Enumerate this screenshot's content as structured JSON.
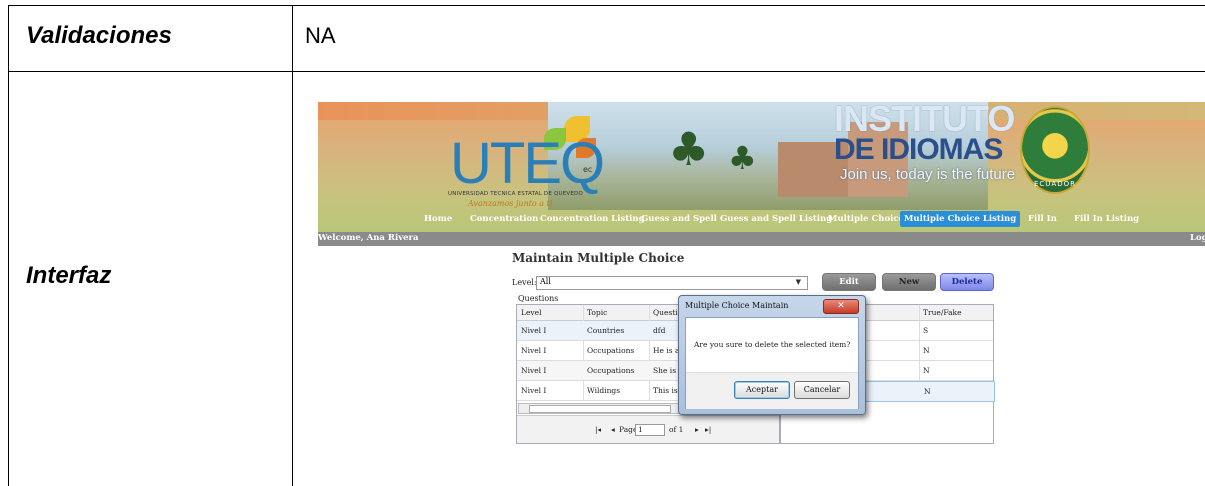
{
  "doc": {
    "row1_label": "Validaciones",
    "row1_value": "NA",
    "row2_label": "Interfaz"
  },
  "app": {
    "logo": {
      "name": "UTEQ",
      "superscript": "ec",
      "subtitle": "UNIVERSIDAD TECNICA ESTATAL DE QUEVEDO",
      "slogan": "Avanzamos junto a ti"
    },
    "institute": {
      "line1": "INSTITUTO",
      "line2": "DE IDIOMAS",
      "slogan": "Join us, today is the future",
      "seal_text": "ECUADOR"
    },
    "nav": [
      "Home",
      "Concentration",
      "Concentration Listing",
      "Guess and Spell",
      "Guess and Spell Listing",
      "Multiple Choice",
      "Multiple Choice Listing",
      "Fill In",
      "Fill In Listing"
    ],
    "nav_active_index": 6,
    "welcome": "Welcome, Ana Rivera",
    "logout_partial": "Log",
    "page_title": "Maintain Multiple Choice",
    "level_label": "Level:",
    "level_value": "All",
    "buttons": {
      "edit": "Edit",
      "new": "New",
      "delete": "Delete"
    },
    "grid": {
      "label": "Questions",
      "columns": [
        "Level",
        "Topic",
        "Questi"
      ],
      "rows": [
        [
          "Nivel I",
          "Countries",
          "dfd"
        ],
        [
          "Nivel I",
          "Occupations",
          "He is a"
        ],
        [
          "Nivel I",
          "Occupations",
          "She is"
        ],
        [
          "Nivel I",
          "Wildings",
          "This is"
        ]
      ],
      "pager": {
        "page_label": "Page",
        "page_value": "1",
        "of_label": "of 1"
      }
    },
    "right_grid": {
      "column": "True/Fake",
      "values": [
        "S",
        "N",
        "N",
        "N"
      ]
    },
    "dialog": {
      "title": "Multiple Choice Maintain",
      "message": "Are you sure to delete the selected item?",
      "accept": "Aceptar",
      "cancel": "Cancelar"
    }
  },
  "colors": {
    "nav_active": "#2a8fd8",
    "delete_button": "#7f88ea",
    "banner": "#c9c27f",
    "welcome_bar": "#8a8a8a"
  }
}
